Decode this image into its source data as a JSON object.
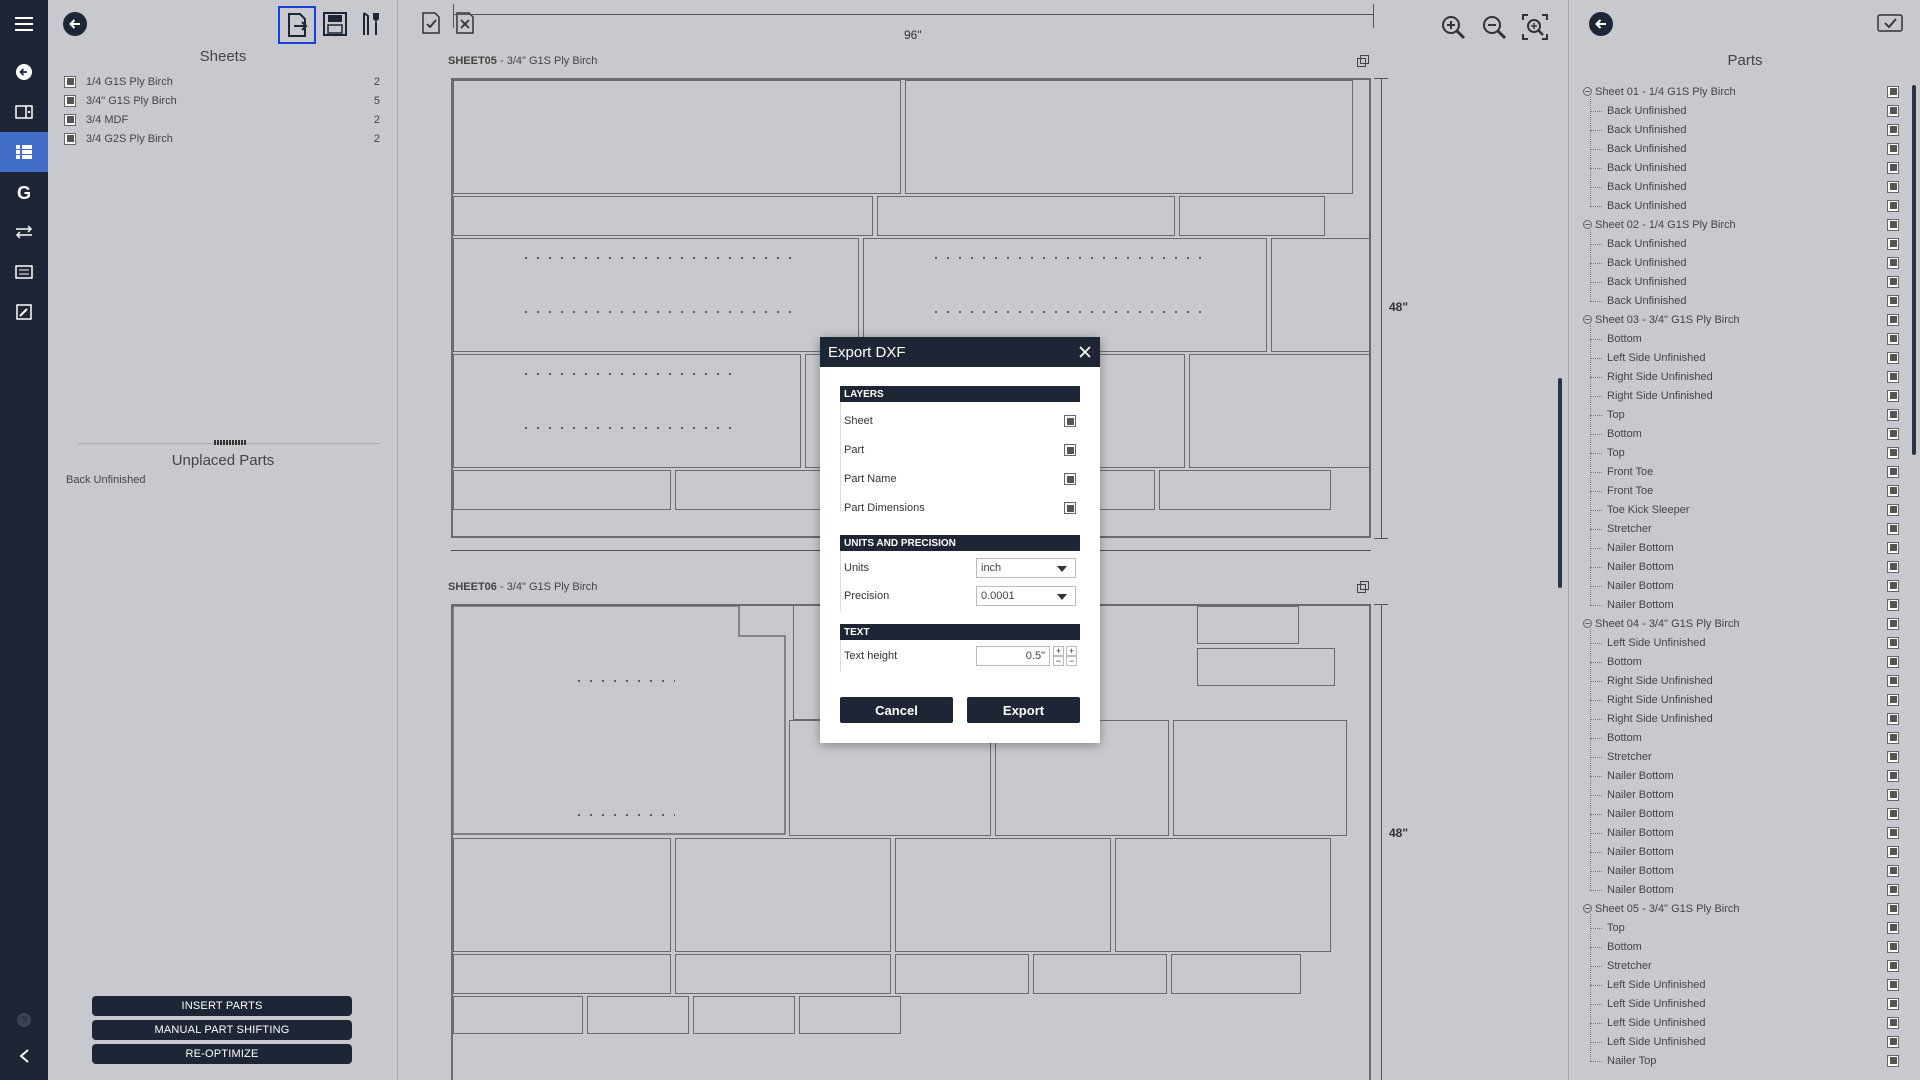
{
  "left_panel": {
    "sheets_title": "Sheets",
    "sheets": [
      {
        "name": "1/4 G1S Ply Birch",
        "count": "2"
      },
      {
        "name": "3/4\" G1S Ply Birch",
        "count": "5"
      },
      {
        "name": "3/4 MDF",
        "count": "2"
      },
      {
        "name": "3/4 G2S Ply Birch",
        "count": "2"
      }
    ],
    "unplaced_title": "Unplaced Parts",
    "unplaced": [
      "Back Unfinished"
    ],
    "buttons": {
      "insert": "INSERT PARTS",
      "manual": "MANUAL PART SHIFTING",
      "reoptimize": "RE-OPTIMIZE"
    }
  },
  "canvas": {
    "top_dim": "96\"",
    "sheet05": {
      "id": "SHEET05",
      "material": " - 3/4\" G1S Ply Birch",
      "height": "48\""
    },
    "sheet06": {
      "id": "SHEET06",
      "material": " - 3/4\" G1S Ply Birch",
      "height": "48\""
    }
  },
  "modal": {
    "title": "Export DXF",
    "layers_head": "LAYERS",
    "layers": [
      "Sheet",
      "Part",
      "Part Name",
      "Part Dimensions"
    ],
    "units_head": "UNITS AND PRECISION",
    "units_label": "Units",
    "units_value": "inch",
    "precision_label": "Precision",
    "precision_value": "0.0001",
    "text_head": "TEXT",
    "text_height_label": "Text height",
    "text_height_value": "0.5\"",
    "cancel": "Cancel",
    "export": "Export"
  },
  "right_panel": {
    "title": "Parts",
    "groups": [
      {
        "name": "Sheet 01 - 1/4 G1S Ply Birch",
        "items": [
          "Back Unfinished",
          "Back Unfinished",
          "Back Unfinished",
          "Back Unfinished",
          "Back Unfinished",
          "Back Unfinished"
        ]
      },
      {
        "name": "Sheet 02 - 1/4 G1S Ply Birch",
        "items": [
          "Back Unfinished",
          "Back Unfinished",
          "Back Unfinished",
          "Back Unfinished"
        ]
      },
      {
        "name": "Sheet 03 - 3/4\" G1S Ply Birch",
        "items": [
          "Bottom",
          "Left Side Unfinished",
          "Right Side Unfinished",
          "Right Side Unfinished",
          "Top",
          "Bottom",
          "Top",
          "Front Toe",
          "Front Toe",
          "Toe Kick Sleeper",
          "Stretcher",
          "Nailer Bottom",
          "Nailer Bottom",
          "Nailer Bottom",
          "Nailer Bottom"
        ]
      },
      {
        "name": "Sheet 04 - 3/4\" G1S Ply Birch",
        "items": [
          "Left Side Unfinished",
          "Bottom",
          "Right Side Unfinished",
          "Right Side Unfinished",
          "Right Side Unfinished",
          "Bottom",
          "Stretcher",
          "Nailer Bottom",
          "Nailer Bottom",
          "Nailer Bottom",
          "Nailer Bottom",
          "Nailer Bottom",
          "Nailer Bottom",
          "Nailer Bottom"
        ]
      },
      {
        "name": "Sheet 05 - 3/4\" G1S Ply Birch",
        "items": [
          "Top",
          "Bottom",
          "Stretcher",
          "Left Side Unfinished",
          "Left Side Unfinished",
          "Left Side Unfinished",
          "Left Side Unfinished",
          "Nailer Top"
        ]
      }
    ]
  },
  "colors": {
    "dark": "#1e2535",
    "accent": "#3f6cc7",
    "bg": "#c8c9ce",
    "highlight": "#1a3fd6"
  }
}
